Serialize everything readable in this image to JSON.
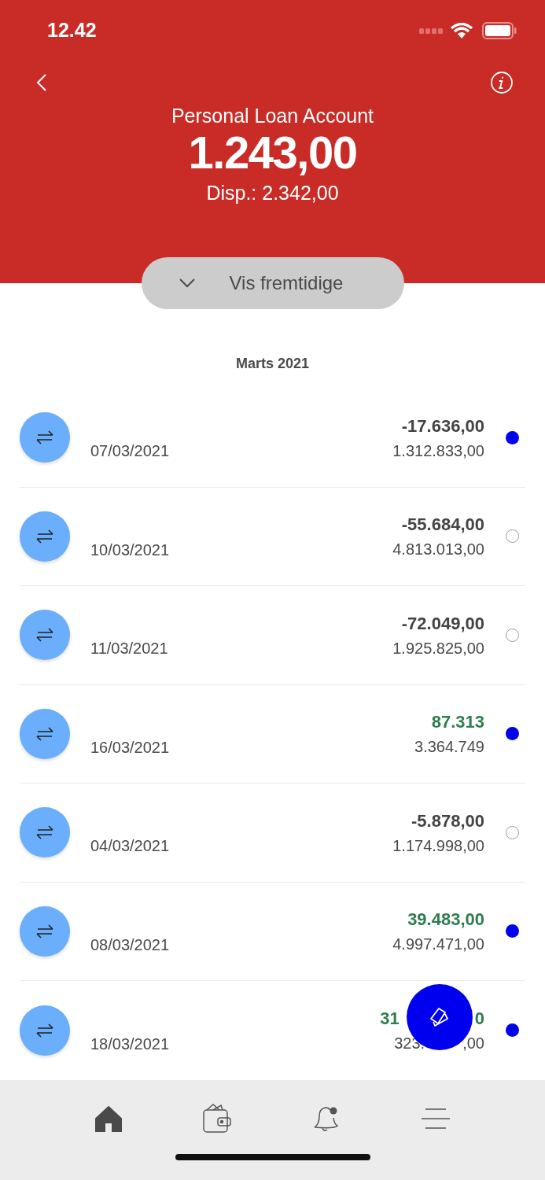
{
  "status_bar": {
    "time": "12.42"
  },
  "header": {
    "title": "Personal Loan Account",
    "balance": "1.243,00",
    "available": "Disp.: 2.342,00"
  },
  "toggle": {
    "label": "Vis fremtidige",
    "expanded": false
  },
  "month": "Marts 2021",
  "transactions": [
    {
      "date": "07/03/2021",
      "amount": "-17.636,00",
      "balance": "1.312.833,00",
      "kind": "debit",
      "marked": true
    },
    {
      "date": "10/03/2021",
      "amount": "-55.684,00",
      "balance": "4.813.013,00",
      "kind": "debit",
      "marked": false
    },
    {
      "date": "11/03/2021",
      "amount": "-72.049,00",
      "balance": "1.925.825,00",
      "kind": "debit",
      "marked": false
    },
    {
      "date": "16/03/2021",
      "amount": "87.313",
      "balance": "3.364.749",
      "kind": "credit",
      "marked": true
    },
    {
      "date": "04/03/2021",
      "amount": "-5.878,00",
      "balance": "1.174.998,00",
      "kind": "debit",
      "marked": false
    },
    {
      "date": "08/03/2021",
      "amount": "39.483,00",
      "balance": "4.997.471,00",
      "kind": "credit",
      "marked": true
    },
    {
      "date": "18/03/2021",
      "amount": "31",
      "amount_end": "0",
      "balance": "323.",
      "balance_end": ",00",
      "kind": "credit",
      "marked": true
    }
  ],
  "nav": [
    {
      "kind": "home",
      "selected": true
    },
    {
      "kind": "wallet",
      "selected": false
    },
    {
      "kind": "bell",
      "selected": false
    },
    {
      "kind": "menu",
      "selected": false
    }
  ]
}
